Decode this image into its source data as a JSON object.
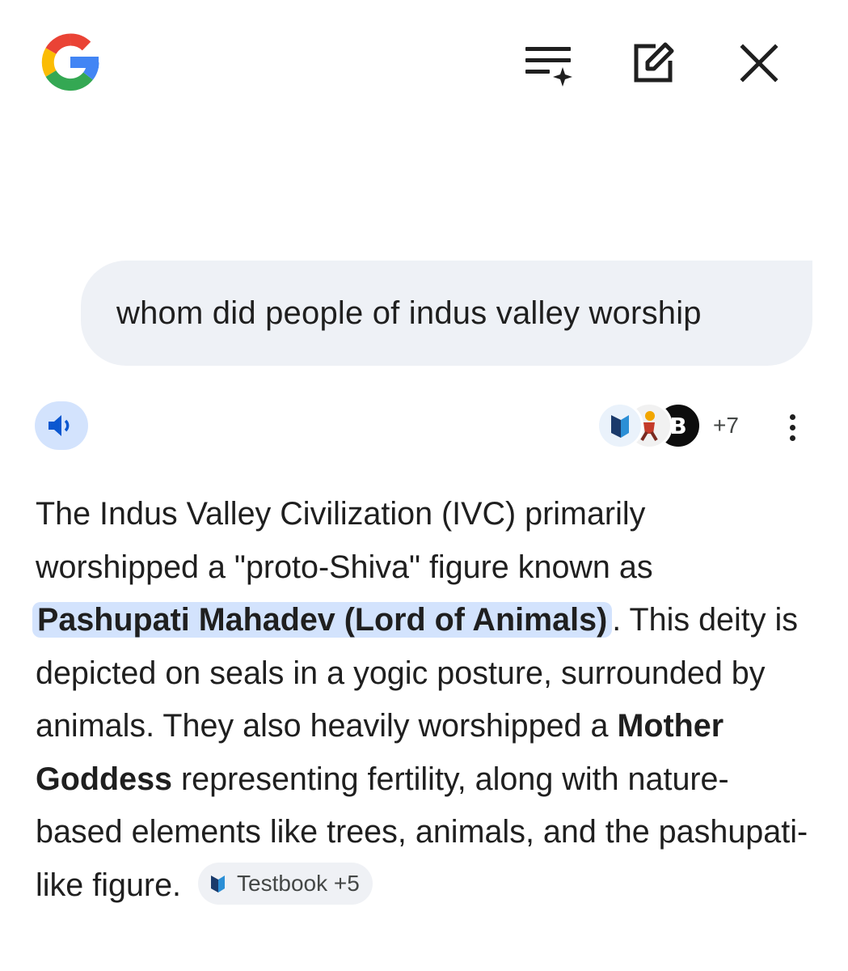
{
  "header": {
    "logo_icon": "google-g-icon",
    "summary_icon": "summary-sparkle-icon",
    "compose_icon": "edit-icon",
    "close_icon": "close-icon"
  },
  "query": {
    "text": "whom did people of indus valley worship"
  },
  "response": {
    "speak_icon": "volume-icon",
    "sources_extra": "+7",
    "source_avatar_letter": "B",
    "more_icon": "more-vert-icon",
    "part1": "The Indus Valley Civilization (IVC) primarily worshipped a \"proto-Shiva\" figure known as ",
    "highlight": "Pashupati Mahadev (Lord of Animals)",
    "part2": ". This deity is depicted on seals in a yogic posture, surrounded by animals. They also heavily worshipped a ",
    "bold2": "Mother Goddess",
    "part3": " representing fertility, along with nature-based elements like trees, animals, and the pashupati-like figure.",
    "citation": "Testbook +5"
  },
  "colors": {
    "accent_blue": "#0b57d0",
    "highlight_bg": "#d3e3fd",
    "bubble_bg": "#eef1f6"
  }
}
